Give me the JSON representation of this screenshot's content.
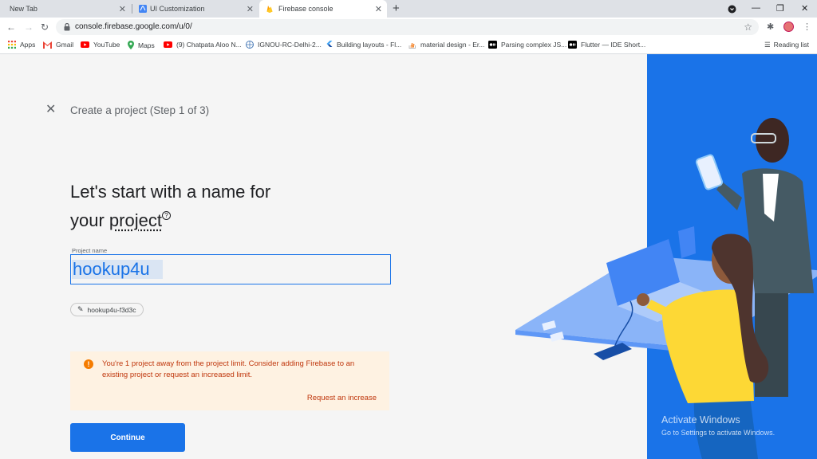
{
  "tabs": [
    {
      "label": "New Tab"
    },
    {
      "label": "UI Customization"
    },
    {
      "label": "Firebase console",
      "active": true
    }
  ],
  "toolbar": {
    "url": "console.firebase.google.com/u/0/"
  },
  "bookmarks": {
    "items": [
      {
        "label": "Apps",
        "icon": "apps-grid-icon"
      },
      {
        "label": "Gmail",
        "icon": "gmail-icon"
      },
      {
        "label": "YouTube",
        "icon": "youtube-icon"
      },
      {
        "label": "Maps",
        "icon": "maps-icon"
      },
      {
        "label": "(9) Chatpata Aloo N...",
        "icon": "youtube-icon"
      },
      {
        "label": "IGNOU-RC-Delhi-2...",
        "icon": "globe-icon"
      },
      {
        "label": "Building layouts - Fl...",
        "icon": "flutter-icon"
      },
      {
        "label": "material design - Er...",
        "icon": "stackoverflow-icon"
      },
      {
        "label": "Parsing complex JS...",
        "icon": "medium-icon"
      },
      {
        "label": "Flutter — IDE Short...",
        "icon": "medium-icon"
      }
    ],
    "reading_list": "Reading list"
  },
  "page": {
    "step_title": "Create a project (Step 1 of 3)",
    "heading_line1": "Let's start with a name for",
    "heading_line2_prefix": "your ",
    "heading_line2_word": "project",
    "field_label": "Project name",
    "field_value": "hookup4u",
    "project_id": "hookup4u-f3d3c",
    "warning_text": "You're 1 project away from the project limit. Consider adding Firebase to an existing project or request an increased limit.",
    "warning_link": "Request an increase",
    "continue_label": "Continue"
  },
  "watermark": {
    "line1": "Activate Windows",
    "line2": "Go to Settings to activate Windows."
  },
  "colors": {
    "primary": "#1a73e8",
    "warning_bg": "#fef2e2",
    "warning_text": "#bf360c",
    "illustration_bg": "#1a73e8"
  }
}
